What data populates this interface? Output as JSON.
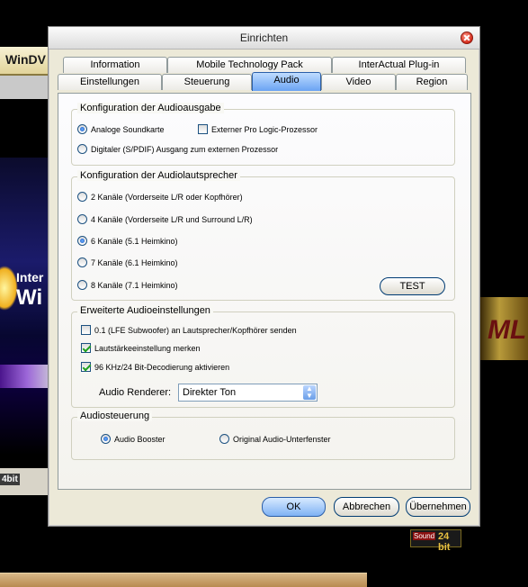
{
  "background": {
    "app_name": "WinDV",
    "art_text_top": "Inter",
    "art_text_bottom": "Wi",
    "bottom_left_label": "4bit",
    "right_art_text": "ML"
  },
  "dialog": {
    "title": "Einrichten",
    "tabs_row1": [
      "Information",
      "Mobile Technology Pack",
      "InterActual Plug-in"
    ],
    "tabs_row2": [
      "Einstellungen",
      "Steuerung",
      "Audio",
      "Video",
      "Region"
    ],
    "active_tab": "Audio",
    "audio_output": {
      "legend": "Konfiguration der Audioausgabe",
      "analog_label": "Analoge Soundkarte",
      "external_prologic_label": "Externer Pro Logic-Prozessor",
      "digital_label": "Digitaler (S/PDIF) Ausgang zum externen Prozessor",
      "analog_selected": true,
      "external_prologic_checked": false
    },
    "speakers": {
      "legend": "Konfiguration der Audiolautsprecher",
      "options": [
        "2 Kanäle (Vorderseite L/R oder Kopfhörer)",
        "4 Kanäle (Vorderseite L/R und Surround L/R)",
        "6 Kanäle (5.1 Heimkino)",
        "7 Kanäle (6.1 Heimkino)",
        "8 Kanäle (7.1 Heimkino)"
      ],
      "selected_index": 2,
      "test_label": "TEST"
    },
    "advanced": {
      "legend": "Erweiterte Audioeinstellungen",
      "lfe_label": "0.1 (LFE Subwoofer) an Lautsprecher/Kopfhörer senden",
      "volume_label": "Lautstärkeeinstellung merken",
      "decoding_label": "96 KHz/24 Bit-Decodierung aktivieren",
      "lfe_checked": false,
      "volume_checked": true,
      "decoding_checked": true,
      "renderer_label": "Audio Renderer:",
      "renderer_value": "Direkter Ton"
    },
    "audio_control": {
      "legend": "Audiosteuerung",
      "booster_label": "Audio Booster",
      "original_label": "Original Audio-Unterfenster",
      "booster_selected": true
    },
    "badge": {
      "left": "Sound",
      "right": "24 bit"
    },
    "buttons": {
      "ok": "OK",
      "cancel": "Abbrechen",
      "apply": "Übernehmen"
    }
  }
}
